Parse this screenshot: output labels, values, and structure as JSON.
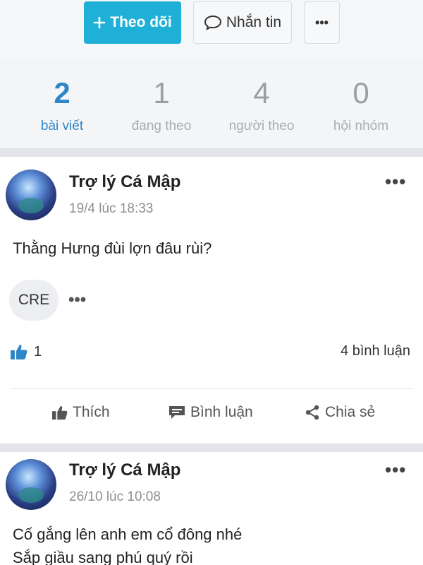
{
  "profile_actions": {
    "follow_label": "Theo dõi",
    "message_label": "Nhắn tin",
    "more_label": "•••"
  },
  "stats": [
    {
      "value": "2",
      "label": "bài viết"
    },
    {
      "value": "1",
      "label": "đang theo"
    },
    {
      "value": "4",
      "label": "người theo"
    },
    {
      "value": "0",
      "label": "hội nhóm"
    }
  ],
  "posts": [
    {
      "author": "Trợ lý Cá Mập",
      "time": "19/4 lúc 18:33",
      "text": "Thằng Hưng đùi lợn đâu rùi?",
      "tag": "CRE",
      "likes": "1",
      "comments": "4 bình luận"
    },
    {
      "author": "Trợ lý Cá Mập",
      "time": "26/10 lúc 10:08",
      "text_line1": "Cố gắng lên anh em cổ đông nhé",
      "text_line2": "Sắp giầu sang phú quý rồi"
    }
  ],
  "actions": {
    "like_label": "Thích",
    "comment_label": "Bình luận",
    "share_label": "Chia sẻ",
    "more_label": "•••"
  },
  "colors": {
    "accent": "#1fb0d8",
    "active_stat": "#2f86c6",
    "like_blue": "#2f86c6"
  }
}
